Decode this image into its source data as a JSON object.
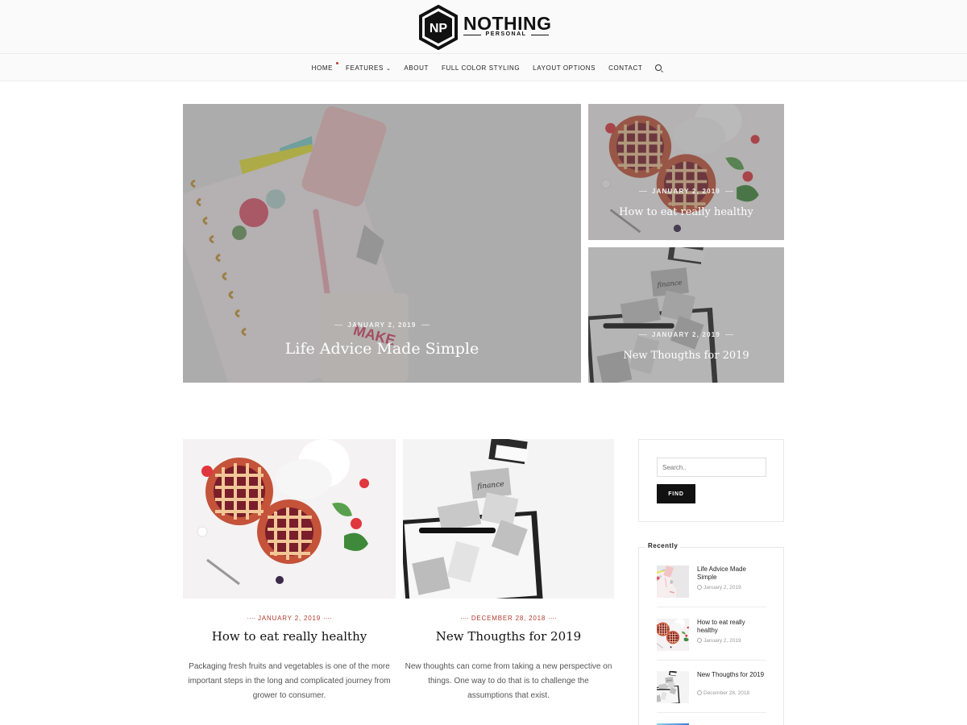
{
  "site": {
    "logo_main": "NOTHING",
    "logo_sub": "PERSONAL",
    "logo_initials": "NP"
  },
  "nav": {
    "items": [
      {
        "label": "HOME",
        "active": true
      },
      {
        "label": "FEATURES",
        "dropdown": true
      },
      {
        "label": "ABOUT"
      },
      {
        "label": "FULL COLOR STYLING"
      },
      {
        "label": "LAYOUT OPTIONS"
      },
      {
        "label": "CONTACT"
      }
    ],
    "search_icon": "search-icon"
  },
  "featured": {
    "main": {
      "date": "JANUARY 2, 2019",
      "title": "Life Advice Made Simple",
      "image": "notebook-flatlay"
    },
    "side_top": {
      "date": "JANUARY 2, 2019",
      "title": "How to eat really healthy",
      "image": "berry-pies"
    },
    "side_bottom": {
      "date": "JANUARY 2, 2019",
      "title": "New Thougths for 2019",
      "image": "budget-notes"
    }
  },
  "posts": [
    {
      "date": "JANUARY 2, 2019",
      "title": "How to eat really healthy",
      "excerpt": "Packaging fresh fruits and vegetables is one of the more important steps in the long and complicated journey from grower to consumer.",
      "image": "berry-pies"
    },
    {
      "date": "DECEMBER 28, 2018",
      "title": "New Thougths for 2019",
      "excerpt": "New thoughts can come from taking a new perspective on things. One way to do that is to challenge the assumptions that exist.",
      "image": "budget-notes"
    }
  ],
  "sidebar": {
    "search": {
      "placeholder": "Search..",
      "button": "FIND"
    },
    "recent": {
      "title": "Recently",
      "items": [
        {
          "title": "Life Advice Made Simple",
          "date": "January 2, 2019",
          "image": "notebook-flatlay"
        },
        {
          "title": "How to eat really healthy",
          "date": "January 2, 2019",
          "image": "berry-pies"
        },
        {
          "title": "New Thougths for 2019",
          "date": "December 28, 2018",
          "image": "budget-notes"
        }
      ]
    }
  },
  "colors": {
    "accent": "#b03a2e",
    "overlay": "#5a5a5a",
    "button": "#111111"
  }
}
